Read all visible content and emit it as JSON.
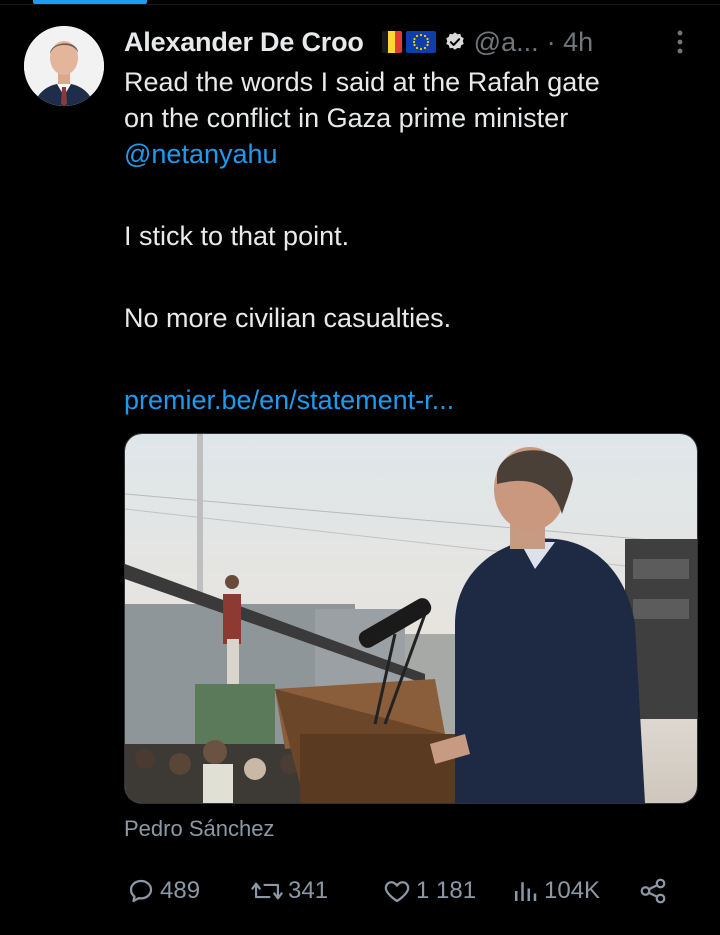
{
  "tweet": {
    "author_name": "Alexander De Croo",
    "handle": "@a...",
    "time": "· 4h",
    "lines": [
      "Read the words I said at the Rafah gate",
      "on the conflict in Gaza prime minister",
      "@netanyahu",
      "",
      "I stick to that point.",
      "",
      "No more civilian casualties.",
      "",
      "premier.be/en/statement-r..."
    ],
    "media_credit": "Pedro Sánchez"
  },
  "actions": {
    "replies": "489",
    "reposts": "341",
    "likes": "1 181",
    "views": "104K"
  },
  "colors": {
    "background": "#000000",
    "text": "#e7e9ea",
    "muted": "#71767b",
    "accent": "#1d9bf0"
  },
  "icons": [
    "more-icon",
    "verified-icon",
    "belgium-flag-icon",
    "eu-flag-icon",
    "reply-icon",
    "repost-icon",
    "like-icon",
    "views-icon",
    "share-icon"
  ]
}
